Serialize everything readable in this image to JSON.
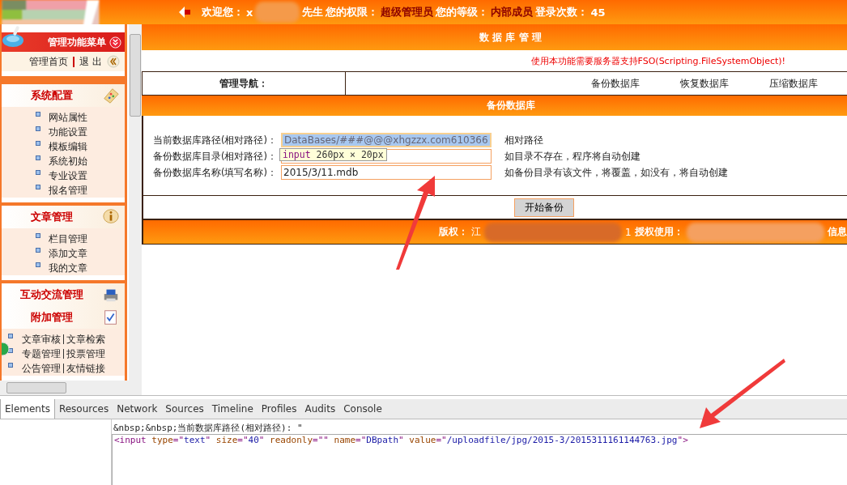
{
  "header": {
    "welcome": "欢迎您：",
    "name_start": "x",
    "name_suffix": "先生",
    "permission_label": "您的权限：",
    "permission": "超级管理员",
    "level_label": "您的等级：",
    "level": "内部成员",
    "login_label": "登录次数：",
    "login_count": "45"
  },
  "sidebar": {
    "title": "管理功能菜单",
    "links": [
      "管理首页",
      "退 出"
    ],
    "sections": [
      {
        "title": "系统配置",
        "expanded": true,
        "items": [
          [
            "网站属性"
          ],
          [
            "功能设置"
          ],
          [
            "模板编辑"
          ],
          [
            "系统初始"
          ],
          [
            "专业设置"
          ],
          [
            "报名管理"
          ]
        ]
      },
      {
        "title": "文章管理",
        "expanded": true,
        "items": [
          [
            "栏目管理"
          ],
          [
            "添加文章"
          ],
          [
            "我的文章"
          ]
        ]
      },
      {
        "title": "互动交流管理",
        "expanded": false
      },
      {
        "title": "附加管理",
        "expanded": true,
        "items": [
          [
            "文章审核",
            "文章检索"
          ],
          [
            "专题管理",
            "投票管理"
          ],
          [
            "公告管理",
            "友情链接"
          ]
        ]
      }
    ]
  },
  "main": {
    "title": "数 据 库 管 理",
    "notice": "使用本功能需要服务器支持FSO(Scripting.FileSystemObject)!",
    "nav_label": "管理导航：",
    "nav_links": [
      "备份数据库",
      "恢复数据库",
      "压缩数据库"
    ],
    "section_title": "备份数据库",
    "fields": [
      {
        "label": "当前数据库路径(相对路径)：",
        "value": "DataBases/###@@@xhgzzx.com610366",
        "selected": true,
        "hint": "相对路径"
      },
      {
        "label": "备份数据库目录(相对路径)：",
        "selected": false,
        "hint": "如目录不存在，程序将自动创建"
      },
      {
        "label": "备份数据库名称(填写名称)：",
        "value": "2015/3/11.mdb",
        "selected": false,
        "hint": "如备份目录有该文件，将覆盖，如没有，将自动创建"
      }
    ],
    "tooltip": {
      "tag": "input",
      "size": "260px × 20px"
    },
    "button": "开始备份",
    "footer": {
      "copyright_label": "版权：",
      "copyright_start": "江",
      "middle": "1",
      "license_label": "授权使用：",
      "end": "信息"
    }
  },
  "devtools": {
    "tabs": [
      {
        "label": "Elements",
        "selected": true
      },
      {
        "label": "Resources",
        "selected": false
      },
      {
        "label": "Network",
        "selected": false
      },
      {
        "label": "Sources",
        "selected": false
      },
      {
        "label": "Timeline",
        "selected": false
      },
      {
        "label": "Profiles",
        "selected": false
      },
      {
        "label": "Audits",
        "selected": false
      },
      {
        "label": "Console",
        "selected": false
      }
    ],
    "text_line": "&nbsp;&nbsp;当前数据库路径(相对路径): \"",
    "code": [
      {
        "kind": "tag",
        "text": "<input "
      },
      {
        "kind": "attr",
        "text": "type"
      },
      {
        "kind": "punct",
        "text": "=\""
      },
      {
        "kind": "value",
        "text": "text"
      },
      {
        "kind": "punct",
        "text": "\" "
      },
      {
        "kind": "attr",
        "text": "size"
      },
      {
        "kind": "punct",
        "text": "=\""
      },
      {
        "kind": "value",
        "text": "40"
      },
      {
        "kind": "punct",
        "text": "\" "
      },
      {
        "kind": "attr",
        "text": "readonly"
      },
      {
        "kind": "punct",
        "text": "=\"\" "
      },
      {
        "kind": "attr",
        "text": "name"
      },
      {
        "kind": "punct",
        "text": "=\""
      },
      {
        "kind": "value",
        "text": "DBpath"
      },
      {
        "kind": "punct",
        "text": "\" "
      },
      {
        "kind": "attr",
        "text": "value"
      },
      {
        "kind": "punct",
        "text": "=\""
      },
      {
        "kind": "value",
        "text": "/uploadfile/jpg/2015-3/2015311161144763.jpg"
      },
      {
        "kind": "punct",
        "text": "\""
      },
      {
        "kind": "tag",
        "text": ">"
      }
    ]
  }
}
